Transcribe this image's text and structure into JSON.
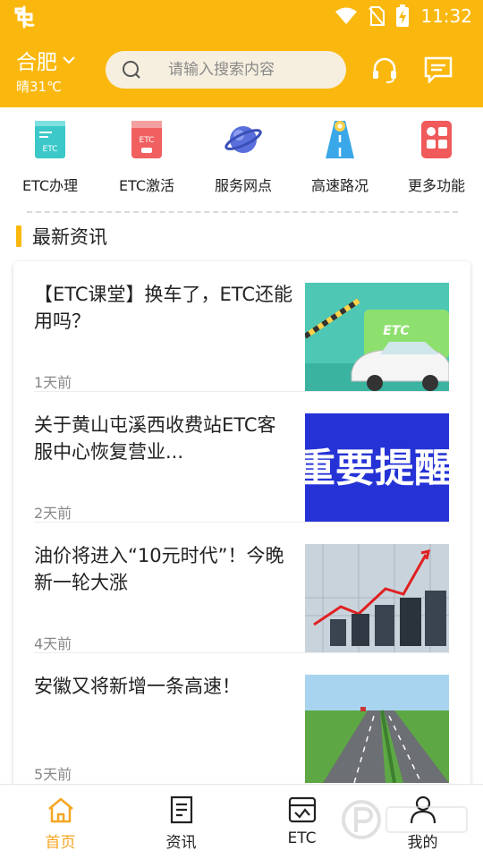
{
  "status_bar": {
    "time": "11:32",
    "icons": [
      "app-icon",
      "wifi-icon",
      "no-sim-icon",
      "battery-charging-icon"
    ]
  },
  "header": {
    "city": "合肥",
    "weather": "晴31℃",
    "search_placeholder": "请输入搜索内容",
    "icons": [
      "chevron-down-icon",
      "search-icon",
      "headset-icon",
      "message-icon"
    ]
  },
  "quick_menu": [
    {
      "label": "ETC办理",
      "icon": "etc-card-icon",
      "icon_text": "ETC",
      "color": "#3cc8c8"
    },
    {
      "label": "ETC激活",
      "icon": "etc-activate-icon",
      "icon_text": "ETC",
      "color": "#f06060"
    },
    {
      "label": "服务网点",
      "icon": "planet-icon",
      "color": "#5a6fdc"
    },
    {
      "label": "高速路况",
      "icon": "road-icon",
      "color": "#3aa8e8"
    },
    {
      "label": "更多功能",
      "icon": "more-apps-icon",
      "color": "#f05a5a"
    }
  ],
  "news_section": {
    "title": "最新资讯",
    "items": [
      {
        "title": "【ETC课堂】换车了，ETC还能用吗？",
        "time": "1天前",
        "thumb_text": "ETC"
      },
      {
        "title": "关于黄山屯溪西收费站ETC客服中心恢复营业...",
        "time": "2天前",
        "thumb_text": "重要提醒"
      },
      {
        "title": "油价将进入“10元时代”！今晚新一轮大涨",
        "time": "4天前"
      },
      {
        "title": "安徽又将新增一条高速！",
        "time": "5天前"
      }
    ]
  },
  "bottom_nav": [
    {
      "label": "首页",
      "icon": "home-icon",
      "active": true
    },
    {
      "label": "资讯",
      "icon": "news-icon",
      "active": false
    },
    {
      "label": "ETC",
      "icon": "etc-box-icon",
      "active": false
    },
    {
      "label": "我的",
      "icon": "user-icon",
      "active": false
    }
  ],
  "colors": {
    "brand": "#fab80f",
    "active_tab": "#f5a623",
    "text": "#222222",
    "muted": "#888888"
  }
}
